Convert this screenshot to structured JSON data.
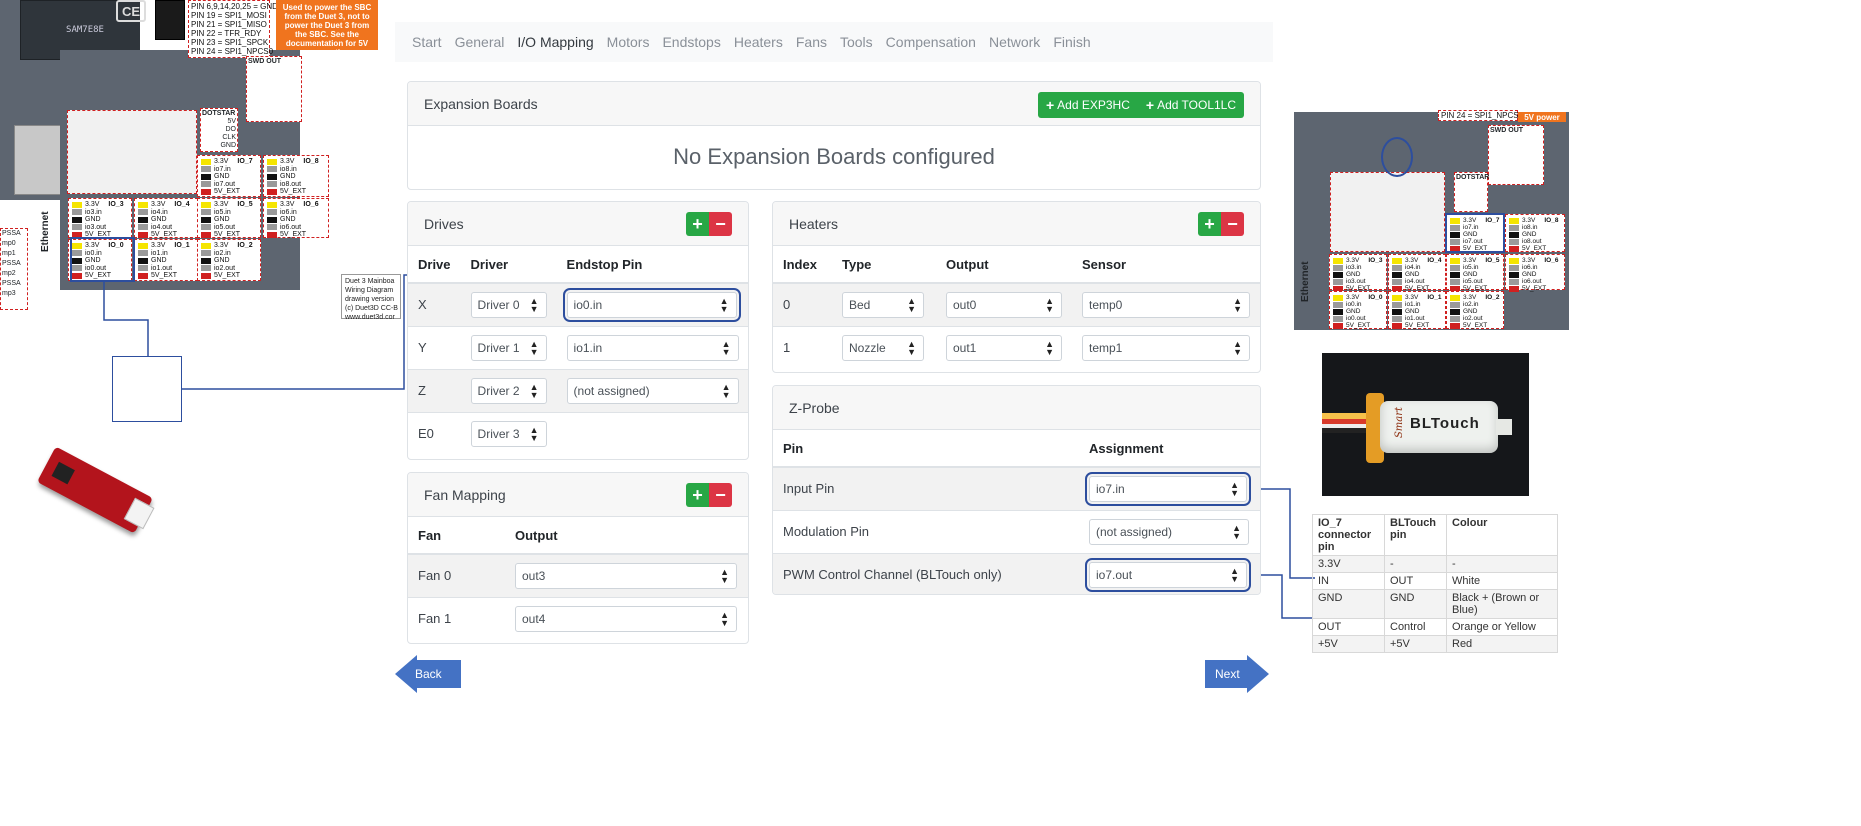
{
  "wizard": {
    "steps": [
      "Start",
      "General",
      "I/O Mapping",
      "Motors",
      "Endstops",
      "Heaters",
      "Fans",
      "Tools",
      "Compensation",
      "Network",
      "Finish"
    ],
    "active_step": "I/O Mapping",
    "expansion": {
      "title": "Expansion Boards",
      "add_exp_label": "Add EXP3HC",
      "add_tool_label": "Add TOOL1LC",
      "empty_text": "No Expansion Boards configured"
    },
    "drives": {
      "title": "Drives",
      "headers": [
        "Drive",
        "Driver",
        "Endstop Pin"
      ],
      "rows": [
        {
          "drive": "X",
          "driver": "Driver 0",
          "endstop": "io0.in"
        },
        {
          "drive": "Y",
          "driver": "Driver 1",
          "endstop": "io1.in"
        },
        {
          "drive": "Z",
          "driver": "Driver 2",
          "endstop": "(not assigned)"
        },
        {
          "drive": "E0",
          "driver": "Driver 3",
          "endstop": ""
        }
      ]
    },
    "fans": {
      "title": "Fan Mapping",
      "headers": [
        "Fan",
        "Output"
      ],
      "rows": [
        {
          "fan": "Fan 0",
          "output": "out3"
        },
        {
          "fan": "Fan 1",
          "output": "out4"
        }
      ]
    },
    "heaters": {
      "title": "Heaters",
      "headers": [
        "Index",
        "Type",
        "Output",
        "Sensor"
      ],
      "rows": [
        {
          "index": "0",
          "type": "Bed",
          "output": "out0",
          "sensor": "temp0"
        },
        {
          "index": "1",
          "type": "Nozzle",
          "output": "out1",
          "sensor": "temp1"
        }
      ]
    },
    "zprobe": {
      "title": "Z-Probe",
      "headers": [
        "Pin",
        "Assignment"
      ],
      "rows": [
        {
          "pin": "Input Pin",
          "value": "io7.in"
        },
        {
          "pin": "Modulation Pin",
          "value": "(not assigned)"
        },
        {
          "pin": "PWM Control Channel (BLTouch only)",
          "value": "io7.out"
        }
      ]
    },
    "back_label": "Back",
    "next_label": "Next"
  },
  "board_left": {
    "chip": "SAM7E8E",
    "pin_text": "PIN 6,9,14,20,25 = GND\nPIN 19 = SPI1_MOSI\nPIN 21 = SPI1_MISO\nPIN 22 = TFR_RDY\nPIN 23 = SPI1_SPCK\nPIN 24 = SPI1_NPCS0",
    "orange_note": "Used to power the SBC from the Duet 3, not to power the Duet 3 from the SBC. See the documentation for 5V power options",
    "swd_title": "SWD OUT",
    "swd_pins": "SWDIO\nSWDCLK\n3.3V\nRESET\nSWD_EXT_RST\nGND",
    "dotstar_title": "DOTSTAR",
    "dotstar_pins": "5V\nDO\nCLK\nGND",
    "ethernet": "Ethernet",
    "caption": "Duet 3 Mainboa\nWiring Diagram\ndrawing version\n(c) Duet3D CC-B\nwww.duet3d.cor",
    "side_labels": [
      "PSSA",
      "mp0",
      "mp1",
      "PSSA",
      "mp2",
      "PSSA",
      "mp3"
    ]
  },
  "board_right": {
    "pin_text": "PIN 24 = SPI1_NPCS0",
    "orange_note": "5V power",
    "swd_title": "SWD OUT",
    "dotstar_title": "DOTSTAR",
    "ethernet": "Ethernet"
  },
  "io_blocks": [
    {
      "name": "IO_7",
      "lines": [
        "3.3V",
        "io7.in",
        "GND",
        "io7.out",
        "5V_EXT"
      ]
    },
    {
      "name": "IO_8",
      "lines": [
        "3.3V",
        "io8.in",
        "GND",
        "io8.out",
        "5V_EXT"
      ]
    },
    {
      "name": "IO_3",
      "lines": [
        "3.3V",
        "io3.in",
        "GND",
        "io3.out",
        "5V_EXT"
      ]
    },
    {
      "name": "IO_4",
      "lines": [
        "3.3V",
        "io4.in",
        "GND",
        "io4.out",
        "5V_EXT"
      ]
    },
    {
      "name": "IO_5",
      "lines": [
        "3.3V",
        "io5.in",
        "GND",
        "io5.out",
        "5V_EXT"
      ]
    },
    {
      "name": "IO_6",
      "lines": [
        "3.3V",
        "io6.in",
        "GND",
        "io6.out",
        "5V_EXT"
      ]
    },
    {
      "name": "IO_0",
      "lines": [
        "3.3V",
        "io0.in",
        "GND",
        "io0.out",
        "5V_EXT"
      ]
    },
    {
      "name": "IO_1",
      "lines": [
        "3.3V",
        "io1.in",
        "GND",
        "io1.out",
        "5V_EXT"
      ]
    },
    {
      "name": "IO_2",
      "lines": [
        "3.3V",
        "io2.in",
        "GND",
        "io2.out",
        "5V_EXT"
      ]
    }
  ],
  "bltouch_photo_label": "BLTouch",
  "bltouch_brand": "Smart",
  "bltouch_table": {
    "headers": [
      "IO_7 connector pin",
      "BLTouch pin",
      "Colour"
    ],
    "rows": [
      [
        "3.3V",
        "-",
        "-"
      ],
      [
        "IN",
        "OUT",
        "White"
      ],
      [
        "GND",
        "GND",
        "Black + (Brown or Blue)"
      ],
      [
        "OUT",
        "Control",
        "Orange or Yellow"
      ],
      [
        "+5V",
        "+5V",
        "Red"
      ]
    ]
  },
  "colors": {
    "accent_blue": "#2d4e9e",
    "green": "#28a745",
    "red": "#dc3545",
    "orange": "#f0741e",
    "board_grey": "#5d6570"
  }
}
